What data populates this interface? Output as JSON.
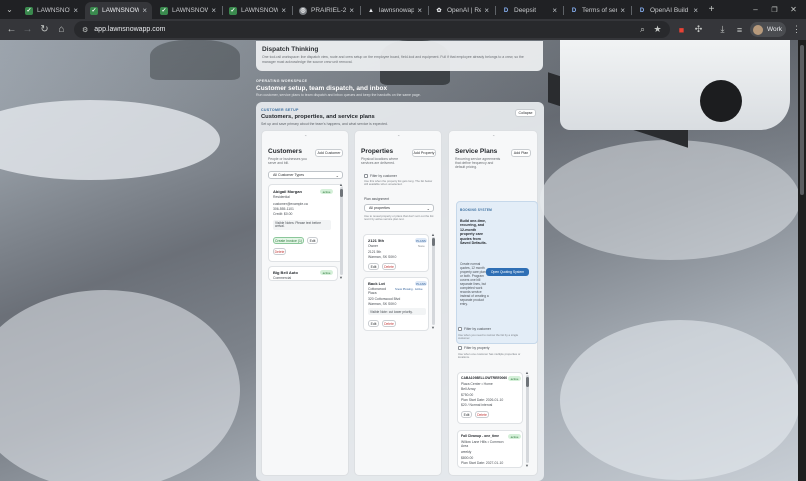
{
  "browser": {
    "tabs": [
      {
        "label": "LAWNSNOW",
        "favicon": "lawnsnow-icon"
      },
      {
        "label": "LAWNSNOW",
        "favicon": "lawnsnow-icon",
        "active": true
      },
      {
        "label": "LAWNSNOW",
        "favicon": "lawnsnow-icon"
      },
      {
        "label": "LAWNSNOW",
        "favicon": "lawnsnow-icon"
      },
      {
        "label": "PRAIRIEL-202",
        "favicon": "globe-icon"
      },
      {
        "label": "lawnsnowapp",
        "favicon": "triangle-icon"
      },
      {
        "label": "OpenAI | Resp",
        "favicon": "openai-icon"
      },
      {
        "label": "Deepsit",
        "favicon": "d-icon"
      },
      {
        "label": "Terms of serv",
        "favicon": "d-icon"
      },
      {
        "label": "OpenAI Build",
        "favicon": "d-icon"
      }
    ],
    "url": "app.lawnsnowapp.com",
    "profile_label": "Work"
  },
  "dispatch": {
    "title": "Dispatch Thinking",
    "desc": "One tool-rail workspace: live dispatch view, route and crew setup on the employee board, field-tool and equipment. Full if that employee already belongs to a crew, so the manager must acknowledge the source crew unit removal."
  },
  "workspace": {
    "kicker": "OPERATING WORKSPACE",
    "title": "Customer setup, team dispatch, and inbox",
    "subtitle": "Run customer, service plans to team dispatch and inbox queues and keep the handoffs on the same page."
  },
  "setup": {
    "kicker": "CUSTOMER SETUP",
    "title": "Customers, properties, and service plans",
    "subtitle": "Set up and save primary about the team's happens, and what service is expected.",
    "collapse_label": "Collapse"
  },
  "customers": {
    "title": "Customers",
    "desc": [
      "People or businesses you",
      "serve and bill."
    ],
    "add_label": "Add Customer",
    "filter_value": "All Customer Types",
    "items": [
      {
        "name": "Abigail Morgan",
        "status": "active",
        "type": "Residential",
        "email": "customer@example.ca",
        "phone": "306-555-1101",
        "credit": "Credit: $0.00",
        "note": "Visible Notes: Please text before arrival.",
        "create_invoice": "Create Invoice (1)",
        "edit": "Edit",
        "delete": "Delete"
      },
      {
        "name": "Big Bell Auto",
        "status": "active",
        "type": "Commercial"
      }
    ]
  },
  "properties": {
    "title": "Properties",
    "desc": [
      "Physical locations where",
      "services are delivered."
    ],
    "add_label": "Add Property",
    "filter_customer_label": "Filter by customer",
    "filter_customer_help": "Use this when the property list gets long. The list below still available when unselected.",
    "plan_assignment_label": "Plan assignment",
    "plan_assignment_value": "All properties",
    "plan_help": "Use to reveal property or plans that don't sort out the list rest it by active service plan text.",
    "items": [
      {
        "name": "2121 5th",
        "badge": "PLANS",
        "badge2": "None",
        "type": "Owner",
        "address": "2121 5th",
        "city": "Warman, SK S0K0",
        "edit": "Edit",
        "delete": "Delete"
      },
      {
        "name": "Back Lot",
        "badge": "PLANS",
        "badge2": "Snow Plowing · Active",
        "owner": "Cottonwood Plaza",
        "address": "320 Cottonwood Blvd",
        "city": "Warman, SK S0K0",
        "note": "Visible Note: cut lower priority.",
        "edit": "Edit",
        "delete": "Delete"
      }
    ]
  },
  "plans": {
    "title": "Service Plans",
    "desc": [
      "Recurring service agreements",
      "that define frequency and",
      "default pricing."
    ],
    "add_label": "Add Plan",
    "callout": {
      "kicker": "BOOKING SYSTEM",
      "lead": "Build one-time, recurring, and 12-month property care quotes from Saved Defaults.",
      "note": "Create normal quotes, 12 month property care plans, or both. Program covers one bill separate lines, but completed work records service instead of creating a separate product entry.",
      "button": "Open Quoting System"
    },
    "filter_customer_label": "Filter by customer",
    "filter_customer_help": "Use when you need to narrow the list by a single customer.",
    "filter_property_label": "Filter by property",
    "filter_property_help": "Use when one customer has multiple properties or locations.",
    "items": [
      {
        "name": "CABA1098ELLOWTREE0060",
        "status": "active",
        "line1": "Plaza Center • Home",
        "line2": "Bell Array",
        "price": "$750.00",
        "start": "Plan Start Date: 2026-01-10",
        "interval": "$20 / Normal interval",
        "edit": "Edit",
        "delete": "Delete"
      },
      {
        "name": "Fall Cleanup - one_time",
        "status": "active",
        "line1": "Willow Lane Hills • Common Area",
        "line2": "weekly",
        "price": "$800.00",
        "start": "Plan Start Date: 2027-01-10"
      }
    ]
  },
  "colors": {
    "accent": "#2f6fb5",
    "active_badge_bg": "#d5f0d9",
    "danger": "#c23a3a"
  }
}
